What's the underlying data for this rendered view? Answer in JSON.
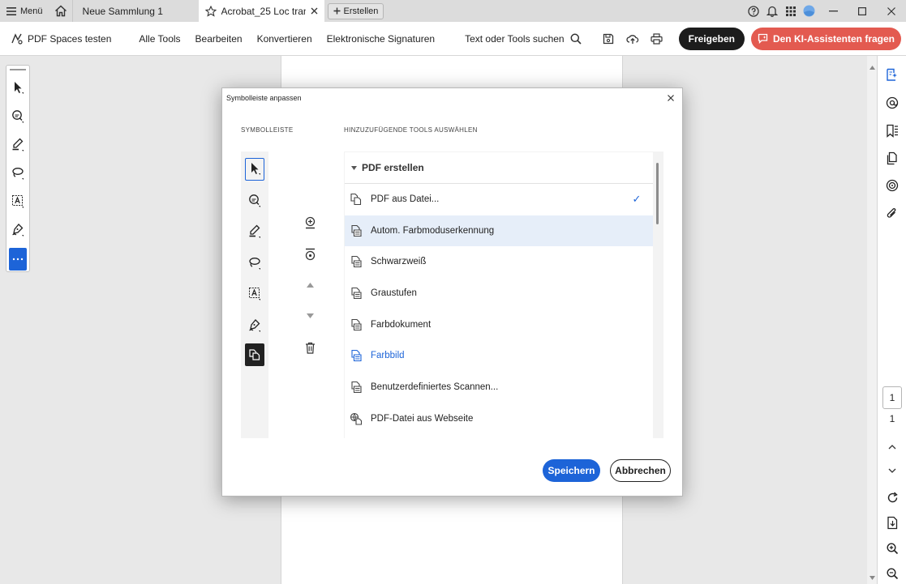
{
  "titlebar": {
    "menu_label": "Menü",
    "tabs": [
      {
        "label": "Neue Sammlung 1"
      },
      {
        "label": "Acrobat_25 Loc tran..."
      }
    ],
    "create_label": "Erstellen"
  },
  "menubar": {
    "spaces_label": "PDF Spaces testen",
    "items": [
      "Alle Tools",
      "Bearbeiten",
      "Konvertieren",
      "Elektronische Signaturen"
    ],
    "search_label": "Text oder Tools suchen",
    "share_label": "Freigeben",
    "ai_label": "Den KI-Assistenten fragen"
  },
  "dialog": {
    "title": "Symbolleiste anpassen",
    "toolbar_section": "SYMBOLLEISTE",
    "tools_section": "HINZUZUFÜGENDE TOOLS AUSWÄHLEN",
    "group_label": "PDF erstellen",
    "items": [
      {
        "label": "PDF aus Datei...",
        "checked": "✓"
      },
      {
        "label": "Autom. Farbmoduserkennung"
      },
      {
        "label": "Schwarzweiß"
      },
      {
        "label": "Graustufen"
      },
      {
        "label": "Farbdokument"
      },
      {
        "label": "Farbbild"
      },
      {
        "label": "Benutzerdefiniertes Scannen..."
      },
      {
        "label": "PDF-Datei aus Webseite"
      }
    ],
    "save_label": "Speichern",
    "cancel_label": "Abbrechen"
  },
  "page_nav": {
    "current": "1",
    "total": "1"
  },
  "colors": {
    "accent": "#1d64d8",
    "ai_button": "#e35a50",
    "share_button": "#1c1c1c",
    "highlight_row": "#e6eef9"
  }
}
